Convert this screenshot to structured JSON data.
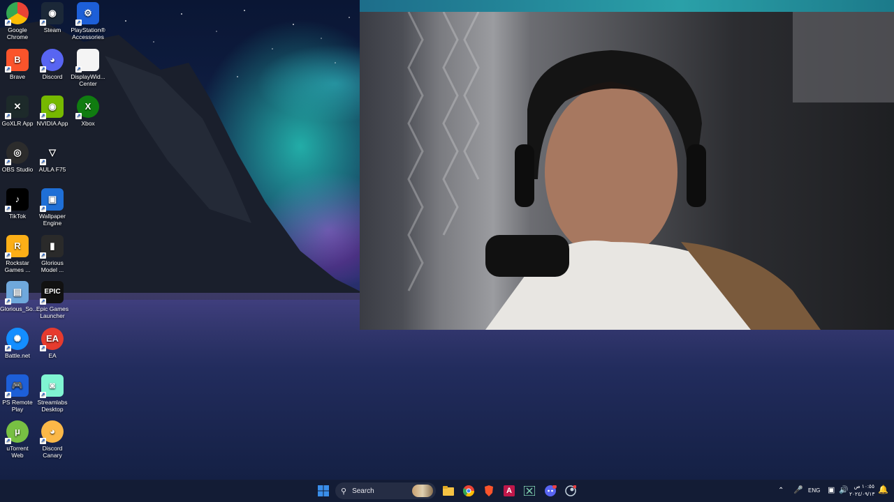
{
  "desktop": {
    "icons": [
      {
        "label": "Google\nChrome",
        "icon": "chrome-icon"
      },
      {
        "label": "Steam",
        "icon": "steam-icon"
      },
      {
        "label": "PlayStation®\nAccessories",
        "icon": "playstation-icon"
      },
      {
        "label": "Brave",
        "icon": "brave-icon"
      },
      {
        "label": "Discord",
        "icon": "discord-icon"
      },
      {
        "label": "DisplayWid...\nCenter",
        "icon": "document-icon"
      },
      {
        "label": "GoXLR App",
        "icon": "goxlr-icon"
      },
      {
        "label": "NVIDIA App",
        "icon": "nvidia-icon"
      },
      {
        "label": "Xbox",
        "icon": "xbox-icon"
      },
      {
        "label": "OBS Studio",
        "icon": "obs-icon"
      },
      {
        "label": "AULA F75",
        "icon": "aula-icon"
      },
      {
        "label": "TikTok",
        "icon": "tiktok-icon"
      },
      {
        "label": "Wallpaper\nEngine",
        "icon": "wallpaper-engine-icon"
      },
      {
        "label": "Rockstar\nGames ...",
        "icon": "rockstar-icon"
      },
      {
        "label": "Glorious\nModel ...",
        "icon": "mouse-icon"
      },
      {
        "label": "Glorious_So...",
        "icon": "installer-icon"
      },
      {
        "label": "Epic Games\nLauncher",
        "icon": "epic-games-icon"
      },
      {
        "label": "Battle.net",
        "icon": "battlenet-icon"
      },
      {
        "label": "EA",
        "icon": "ea-icon"
      },
      {
        "label": "PS Remote\nPlay",
        "icon": "ps-remote-play-icon"
      },
      {
        "label": "Streamlabs\nDesktop",
        "icon": "streamlabs-icon"
      },
      {
        "label": "uTorrent Web",
        "icon": "utorrent-icon"
      },
      {
        "label": "Discord\nCanary",
        "icon": "discord-canary-icon"
      }
    ]
  },
  "taskbar": {
    "search_placeholder": "Search",
    "language": "ENG",
    "time": "١٠:٥٥ ص",
    "date": "٢٠٢٤/٠٩/١٣",
    "pinned": [
      "windows-start-icon",
      "file-explorer-icon",
      "chrome-icon",
      "brave-icon",
      "app-a-icon",
      "goxlr-icon",
      "discord-icon",
      "steam-icon"
    ]
  },
  "colors": {
    "taskbar_bg": "#141c34",
    "windows_blue": "#3a8eea",
    "chrome_red": "#ea4335",
    "discord_blurple": "#5865f2",
    "nvidia_green": "#76b900",
    "xbox_green": "#107c10"
  }
}
